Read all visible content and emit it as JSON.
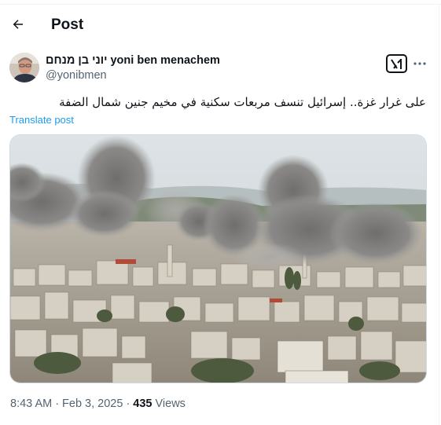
{
  "header": {
    "title": "Post",
    "back_icon": "arrow-left-icon"
  },
  "author": {
    "display_name": "יוני בן מנחם yoni ben menachem",
    "handle": "@yonibmen"
  },
  "post": {
    "text": "على غرار غزة.. إسرائيل تنسف مربعات سكنية في مخيم جنين شمال الضفة",
    "translate_label": "Translate post"
  },
  "meta": {
    "time": "8:43 AM",
    "separator": "·",
    "date": "Feb 3, 2025",
    "view_count": "435",
    "views_label": "Views"
  },
  "icons": {
    "grok": "grok-icon",
    "more": "more-icon"
  },
  "colors": {
    "link": "#1d9bf0",
    "secondary_text": "#536471",
    "primary_text": "#0f1419"
  }
}
